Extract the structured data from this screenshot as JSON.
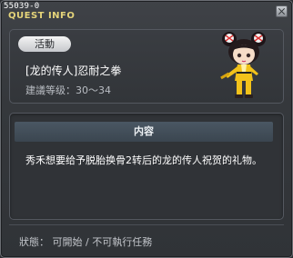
{
  "window": {
    "quest_id": "55039-0",
    "title": "QUEST INFO"
  },
  "quest": {
    "category": "活動",
    "name": "[龙的传人]忍耐之拳",
    "level_label": "建議等级：",
    "level_range": "30～34"
  },
  "content": {
    "header": "内容",
    "description": "秀禾想要给予脱胎换骨2转后的龙的传人祝贺的礼物。"
  },
  "status": {
    "text": "狀態： 可開始 / 不可執行任務"
  },
  "colors": {
    "title_gold": "#e5d47a",
    "background": "#35383c",
    "header_bar": "#3b4650"
  },
  "icons": {
    "close": "close-icon",
    "character": "character-portrait"
  }
}
